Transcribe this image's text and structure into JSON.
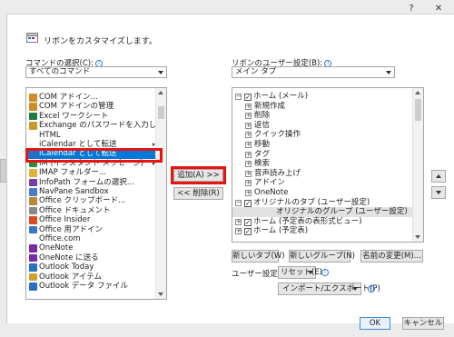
{
  "title_bar": {
    "help": "?",
    "close": "✕"
  },
  "header": {
    "title": "リボンをカスタマイズします。"
  },
  "commands": {
    "label": "コマンドの選択(C):",
    "dropdown_value": "すべてのコマンド",
    "items": [
      {
        "label": "COM アドイン...",
        "icon": "com-addin-icon",
        "color": "#d08c26"
      },
      {
        "label": "COM アドインの管理",
        "icon": "com-addin-manage-icon",
        "color": "#d08c26"
      },
      {
        "label": "Excel ワークシート",
        "icon": "excel-icon",
        "color": "#1f7a44"
      },
      {
        "label": "Exchange のパスワードを入力し...",
        "icon": "key-icon",
        "color": "#c79a2d"
      },
      {
        "label": "HTML",
        "icon": "",
        "color": ""
      },
      {
        "label": "iCalendar として転送",
        "icon": "",
        "color": "",
        "submenu": true
      },
      {
        "label": "iCalendar として転送",
        "icon": "calendar-icon",
        "color": "#2b6cc4",
        "selected": true
      },
      {
        "label": "IM (インスタント メッセージ)",
        "icon": "im-icon",
        "color": "#2a8f3e",
        "submenu": true
      },
      {
        "label": "IMAP フォルダー...",
        "icon": "folder-icon",
        "color": "#e0b23a"
      },
      {
        "label": "InfoPath フォームの選択...",
        "icon": "infopath-icon",
        "color": "#7a3ca0"
      },
      {
        "label": "NavPane Sandbox",
        "icon": "navpane-icon",
        "color": "#4a7cc9"
      },
      {
        "label": "Office クリップボード...",
        "icon": "clipboard-icon",
        "color": "#b88a3a"
      },
      {
        "label": "Office ドキュメント",
        "icon": "document-icon",
        "color": "#8a8a8a"
      },
      {
        "label": "Office Insider",
        "icon": "office-icon",
        "color": "#e0491b"
      },
      {
        "label": "Office 用アドイン",
        "icon": "addin-icon",
        "color": "#3a76c4"
      },
      {
        "label": "Office.com",
        "icon": "",
        "color": ""
      },
      {
        "label": "OneNote",
        "icon": "onenote-icon",
        "color": "#7b2aa5"
      },
      {
        "label": "OneNote に送る",
        "icon": "onenote-send-icon",
        "color": "#7b2aa5"
      },
      {
        "label": "Outlook Today",
        "icon": "outlook-today-icon",
        "color": "#2a6fc4"
      },
      {
        "label": "Outlook アイテム",
        "icon": "outlook-item-icon",
        "color": "#d0a22e"
      },
      {
        "label": "Outlook データ ファイル",
        "icon": "outlook-data-icon",
        "color": "#2a6fc4"
      }
    ]
  },
  "middle": {
    "add": "追加(A) >>",
    "remove": "<< 削除(R)"
  },
  "ribbon": {
    "label": "リボンのユーザー設定(B):",
    "dropdown_value": "メイン タブ",
    "tree": [
      {
        "label": "ホーム (メール)",
        "level": 0,
        "expander": "⊟",
        "checked": true
      },
      {
        "label": "新規作成",
        "level": 1,
        "expander": "⊞"
      },
      {
        "label": "削除",
        "level": 1,
        "expander": "⊞"
      },
      {
        "label": "返信",
        "level": 1,
        "expander": "⊞"
      },
      {
        "label": "クイック操作",
        "level": 1,
        "expander": "⊞"
      },
      {
        "label": "移動",
        "level": 1,
        "expander": "⊞"
      },
      {
        "label": "タグ",
        "level": 1,
        "expander": "⊞"
      },
      {
        "label": "検索",
        "level": 1,
        "expander": "⊞"
      },
      {
        "label": "音声読み上げ",
        "level": 1,
        "expander": "⊞"
      },
      {
        "label": "アドイン",
        "level": 1,
        "expander": "⊞"
      },
      {
        "label": "OneNote",
        "level": 1,
        "expander": "⊞"
      },
      {
        "label": "オリジナルのタブ (ユーザー設定)",
        "level": 0,
        "expander": "⊟",
        "checked": true
      },
      {
        "label": "オリジナルのグループ (ユーザー設定)",
        "level": 1,
        "expander": "",
        "highlight": true
      },
      {
        "label": "ホーム (予定表の表形式ビュー)",
        "level": 0,
        "expander": "⊞",
        "checked": true
      },
      {
        "label": "ホーム (予定表)",
        "level": 0,
        "expander": "⊞",
        "checked": true
      }
    ],
    "new_tab": "新しいタブ(W)",
    "new_group": "新しいグループ(N)",
    "rename": "名前の変更(M)...",
    "user_setting_label": "ユーザー設定:",
    "reset": "リセット(E)",
    "import_export": "インポート/エクスポート(P)"
  },
  "footer": {
    "ok": "OK",
    "cancel": "キャンセル"
  }
}
